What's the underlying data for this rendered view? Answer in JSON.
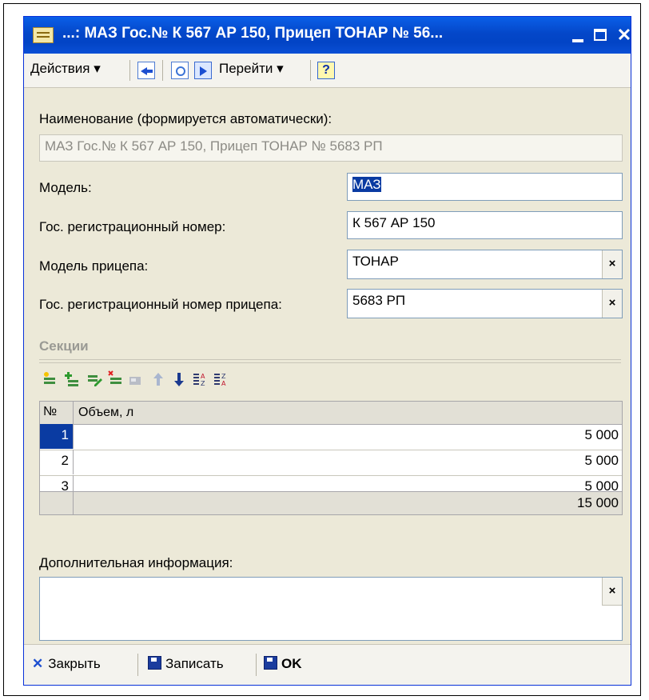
{
  "window": {
    "title": "...: МАЗ Гос.№ К 567 АР 150, Прицеп ТОНАР № 56...",
    "min": "",
    "max": "",
    "close": "✕"
  },
  "toolbar": {
    "actions_label": "Действия ▾",
    "goto_label": "Перейти ▾",
    "help_label": "?"
  },
  "form": {
    "name_label": "Наименование (формируется автоматически):",
    "name_value": "МАЗ Гос.№ К 567 АР 150, Прицеп ТОНАР № 5683 РП",
    "model_label": "Модель:",
    "model_value": "МАЗ",
    "reg_label": "Гос. регистрационный номер:",
    "reg_value": "К 567 АР 150",
    "trailer_model_label": "Модель прицепа:",
    "trailer_model_value": "ТОНАР",
    "trailer_reg_label": "Гос. регистрационный номер прицепа:",
    "trailer_reg_value": "5683 РП",
    "clear_symbol": "×"
  },
  "sections": {
    "title": "Секции",
    "columns": {
      "num": "№",
      "volume": "Объем, л"
    },
    "rows": [
      {
        "num": "1",
        "volume": "5 000"
      },
      {
        "num": "2",
        "volume": "5 000"
      },
      {
        "num": "3",
        "volume": "5 000"
      }
    ],
    "total": "15 000"
  },
  "extra": {
    "label": "Дополнительная информация:",
    "value": "",
    "clear_symbol": "×"
  },
  "footer": {
    "close_label": "Закрыть",
    "close_icon": "✕",
    "save_label": "Записать",
    "ok_label": "OK"
  },
  "colors": {
    "titlebar": "#0447c9",
    "selection": "#0a3ba2",
    "window_bg": "#ece9d8"
  }
}
